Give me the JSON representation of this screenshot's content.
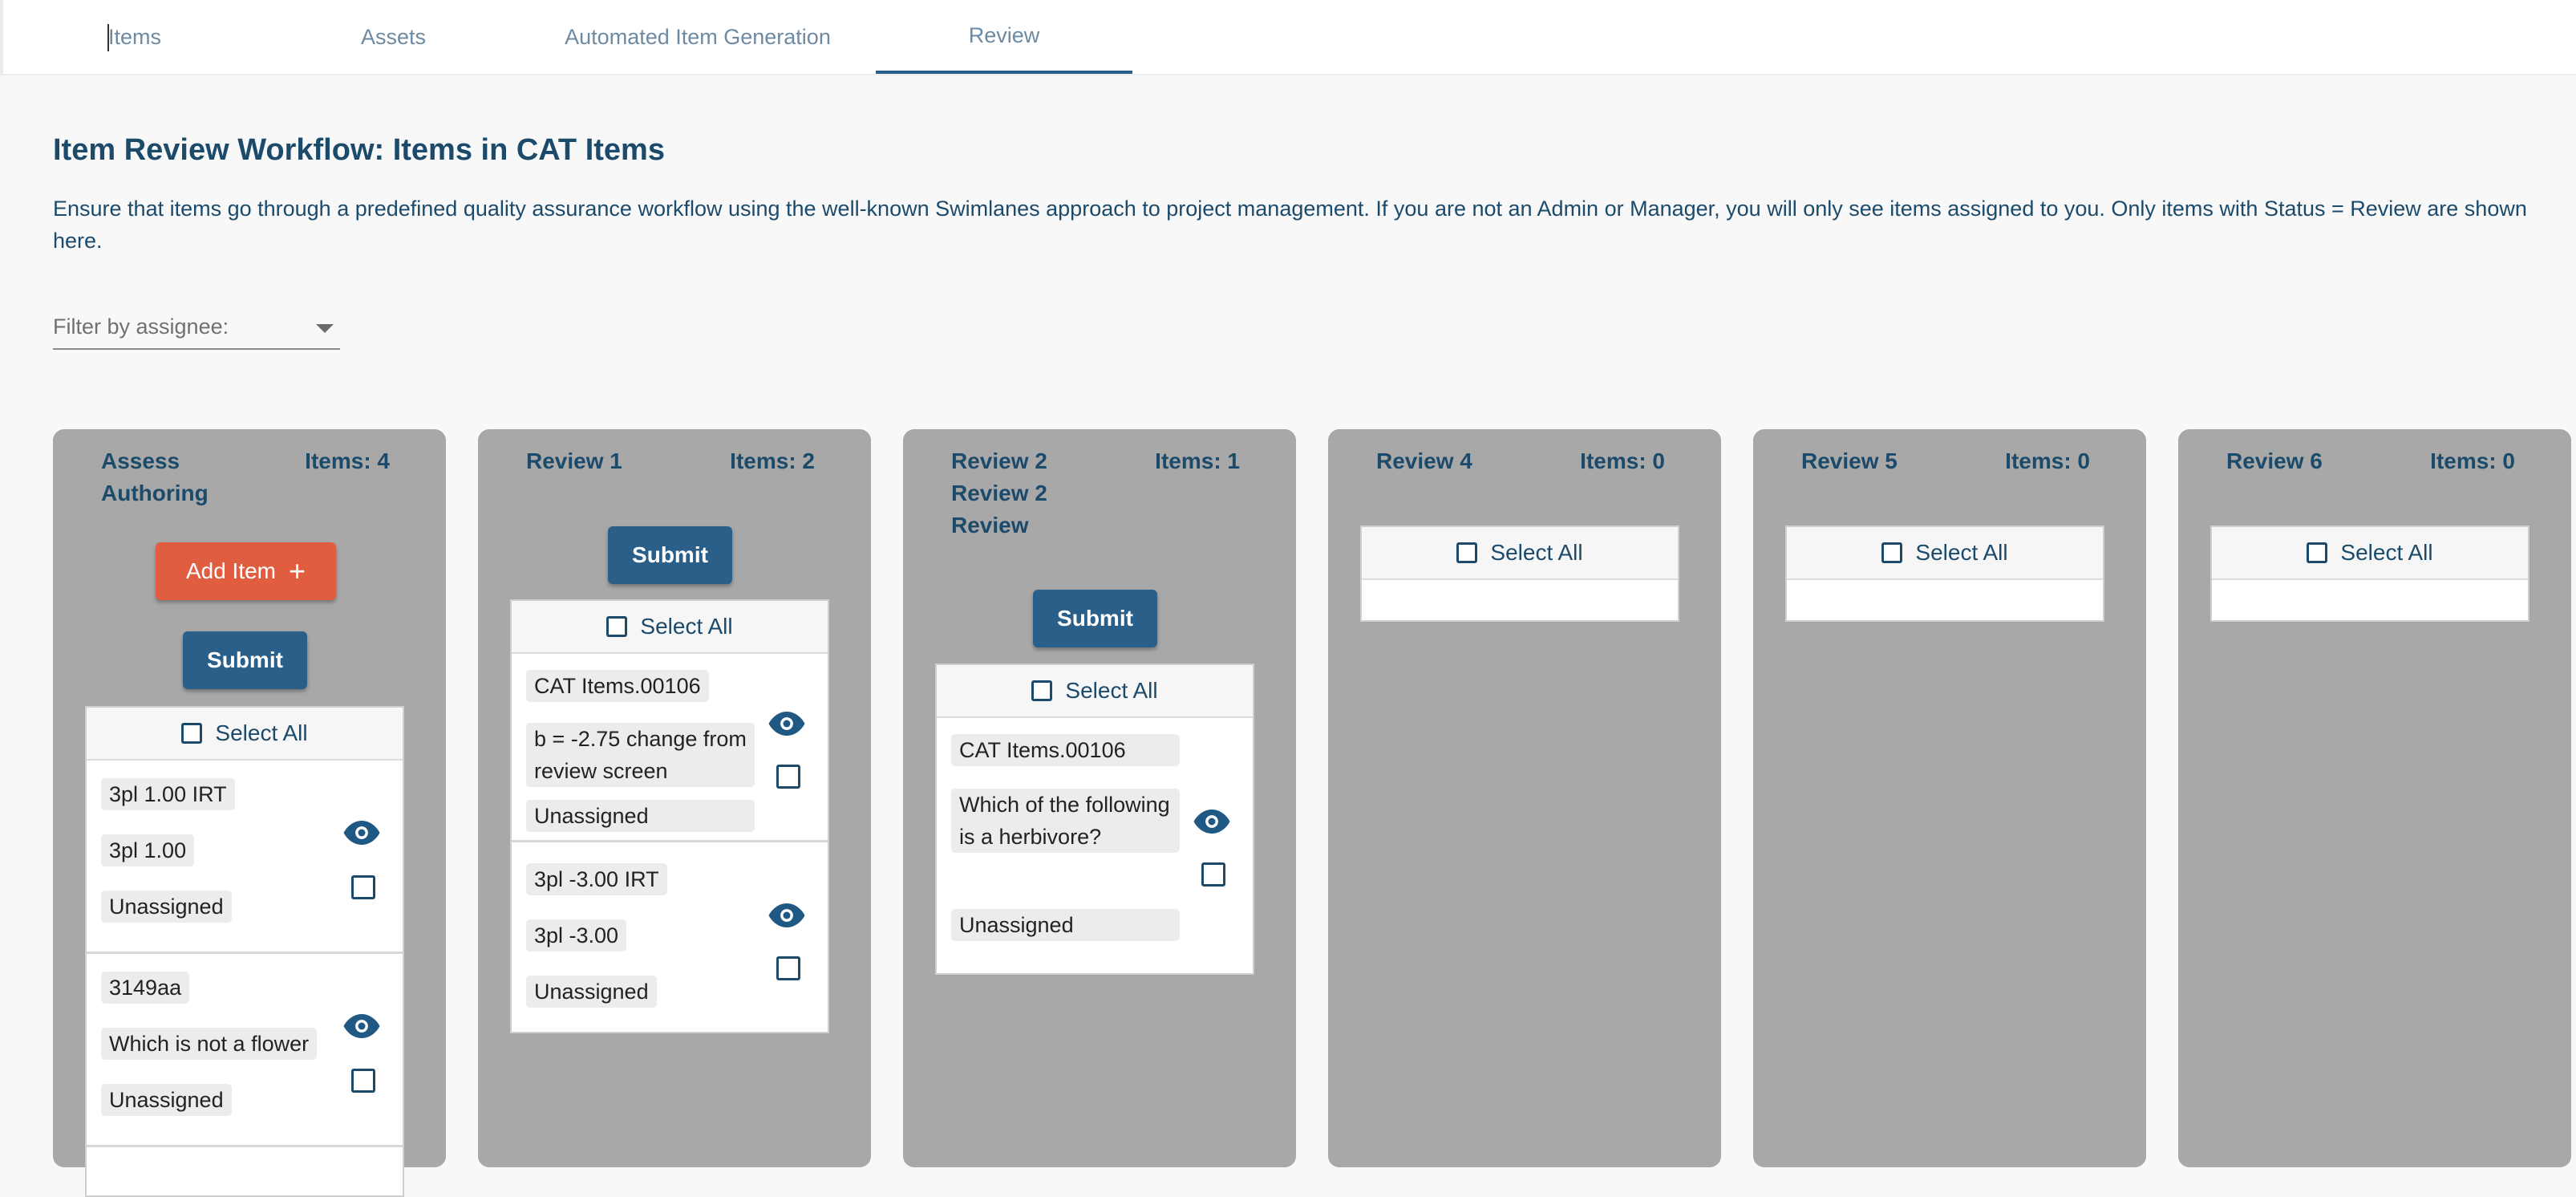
{
  "tabs": [
    {
      "label": "Items"
    },
    {
      "label": "Assets"
    },
    {
      "label": "Automated Item Generation"
    },
    {
      "label": "Review"
    }
  ],
  "active_tab": "Review",
  "page": {
    "title": "Item Review Workflow: Items in CAT Items",
    "description": "Ensure that items go through a predefined quality assurance workflow using the well-known Swimlanes approach to project management. If you are not an Admin or Manager, you will only see items assigned to you. Only items with Status = Review are shown here."
  },
  "filter": {
    "label": "Filter by assignee:",
    "icon": "chevron-down-icon"
  },
  "common": {
    "select_all": "Select All",
    "submit": "Submit",
    "add_item": "Add Item",
    "add_icon": "+"
  },
  "lanes": [
    {
      "title": "Assess Authoring",
      "count": "Items: 4",
      "cards": [
        {
          "line1": "3pl 1.00 IRT",
          "line2": "3pl 1.00",
          "assignee": "Unassigned"
        },
        {
          "line1": "3149aa",
          "line2": "Which is not a flower",
          "assignee": "Unassigned"
        }
      ]
    },
    {
      "title": "Review 1",
      "count": "Items: 2",
      "cards": [
        {
          "line1": "CAT Items.00106",
          "line2": "b = -2.75 change from review screen",
          "assignee": "Unassigned"
        },
        {
          "line1": "3pl -3.00 IRT",
          "line2": "3pl -3.00",
          "assignee": "Unassigned"
        }
      ]
    },
    {
      "title": "Review 2 Review 2 Review",
      "count": "Items: 1",
      "cards": [
        {
          "line1": "CAT Items.00106",
          "line2": "Which of the following is a herbivore?",
          "assignee": "Unassigned"
        }
      ]
    },
    {
      "title": "Review 4",
      "count": "Items: 0",
      "cards": []
    },
    {
      "title": "Review 5",
      "count": "Items: 0",
      "cards": []
    },
    {
      "title": "Review 6",
      "count": "Items: 0",
      "cards": []
    }
  ],
  "colors": {
    "primary": "#2a5f89",
    "accent": "#e05e3f",
    "lane_bg": "#a8a8a8",
    "text": "#1b4a6b"
  }
}
